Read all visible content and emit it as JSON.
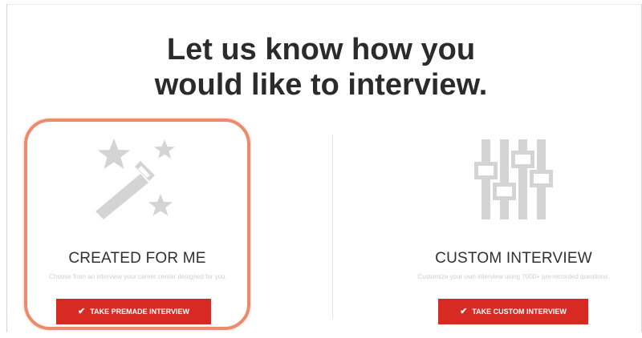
{
  "page": {
    "heading_line1": "Let us know how you",
    "heading_line2": "would like to interview."
  },
  "options": {
    "premade": {
      "title": "CREATED FOR ME",
      "description": "Choose from an interview your career center designed for you.",
      "button_label": "TAKE PREMADE INTERVIEW",
      "icon": "magic-wand-stars-icon"
    },
    "custom": {
      "title": "CUSTOM INTERVIEW",
      "description": "Customize your own interview using 7000+ pre-recorded questions.",
      "button_label": "TAKE CUSTOM INTERVIEW",
      "icon": "sliders-icon"
    }
  },
  "colors": {
    "accent": "#d72a23",
    "highlight": "#ed8a6c",
    "icon_gray": "#d4d4d4"
  }
}
